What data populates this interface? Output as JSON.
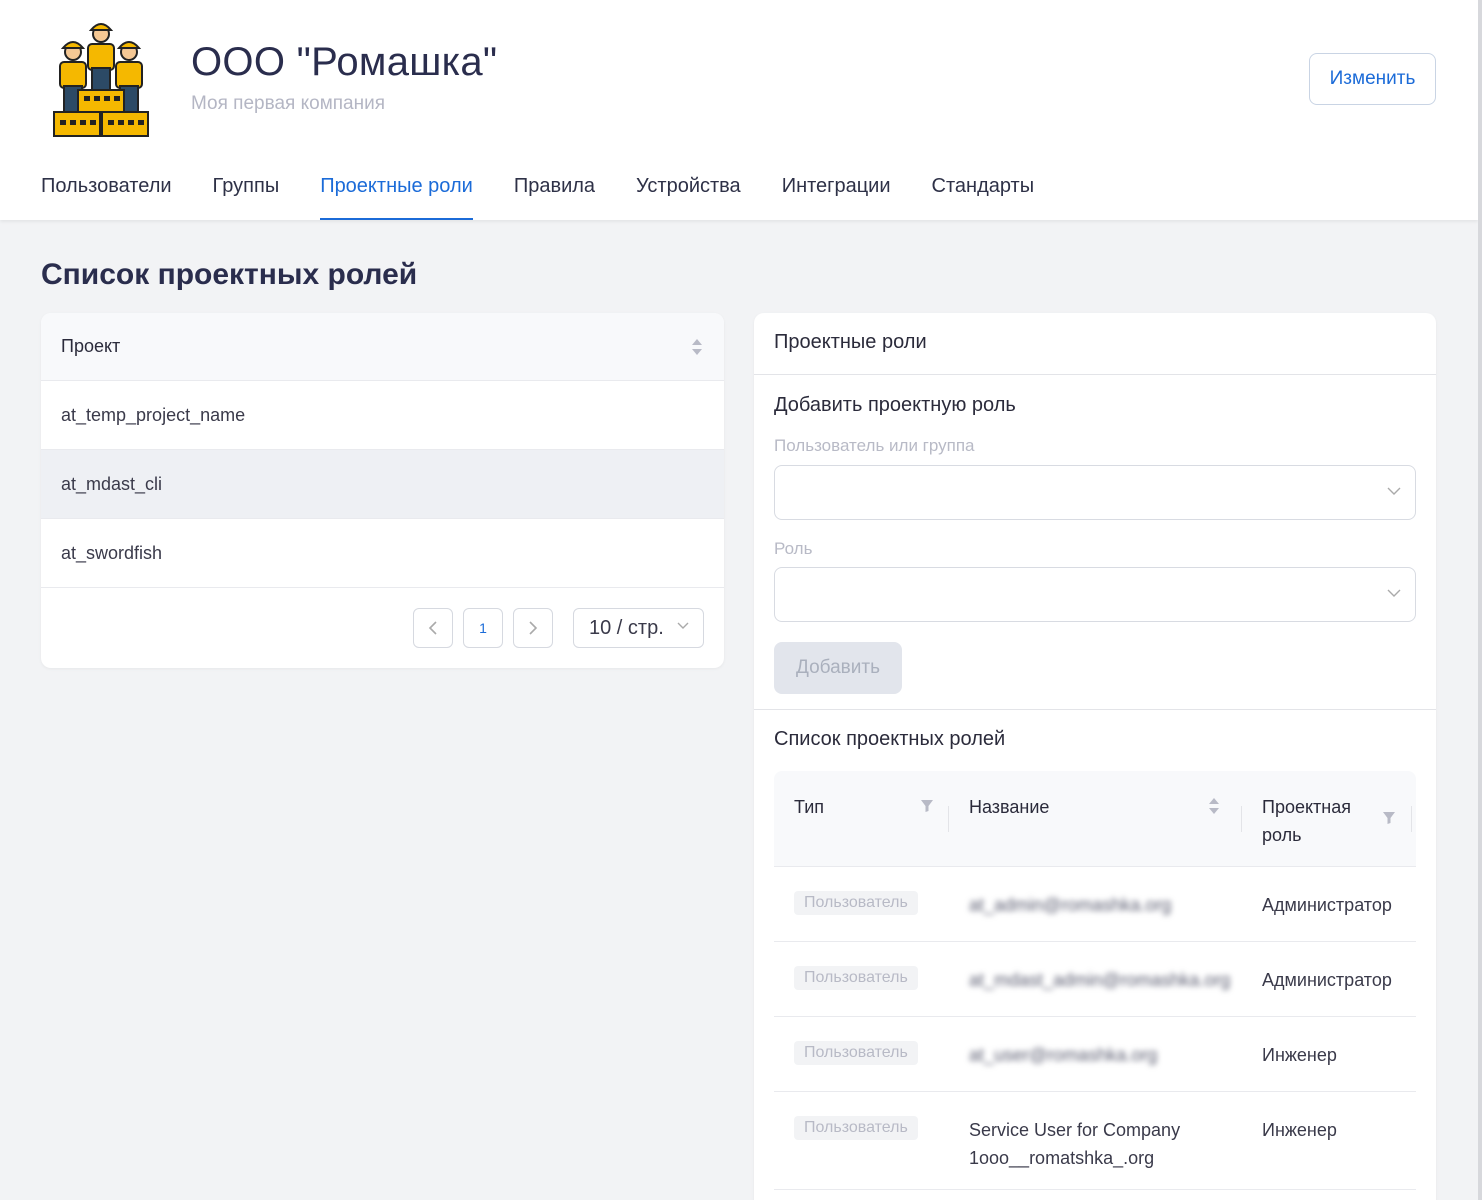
{
  "company": {
    "name": "ООО \"Ромашка\"",
    "subtitle": "Моя первая компания",
    "edit_label": "Изменить"
  },
  "tabs": [
    {
      "label": "Пользователи",
      "active": false
    },
    {
      "label": "Группы",
      "active": false
    },
    {
      "label": "Проектные роли",
      "active": true
    },
    {
      "label": "Правила",
      "active": false
    },
    {
      "label": "Устройства",
      "active": false
    },
    {
      "label": "Интеграции",
      "active": false
    },
    {
      "label": "Стандарты",
      "active": false
    }
  ],
  "page_title": "Список проектных ролей",
  "projects": {
    "column": "Проект",
    "rows": [
      "at_temp_project_name",
      "at_mdast_cli",
      "at_swordfish"
    ],
    "selected_index": 1,
    "pagination": {
      "current_page": "1",
      "page_size": "10 / стр."
    }
  },
  "roles_panel": {
    "title": "Проектные роли",
    "add_section_title": "Добавить проектную роль",
    "user_group_label": "Пользователь или группа",
    "role_label": "Роль",
    "add_button": "Добавить",
    "list_title": "Список проектных ролей",
    "columns": {
      "type": "Тип",
      "name": "Название",
      "role_line1": "Проектная",
      "role_line2": "роль"
    },
    "rows": [
      {
        "type": "Пользователь",
        "name": "at_admin@romashka.org",
        "role": "Администратор",
        "blurred": true
      },
      {
        "type": "Пользователь",
        "name": "at_mdast_admin@romashka.org",
        "role": "Администратор",
        "blurred": true
      },
      {
        "type": "Пользователь",
        "name": "at_user@romashka.org",
        "role": "Инженер",
        "blurred": true
      },
      {
        "type": "Пользователь",
        "name_line1": "Service User for Company",
        "name_line2": "1ooo__romatshka_.org",
        "role": "Инженер",
        "blurred": false
      }
    ]
  },
  "colors": {
    "accent": "#1b6bd8",
    "background": "#f2f3f5",
    "logo_yellow": "#f5b800"
  }
}
